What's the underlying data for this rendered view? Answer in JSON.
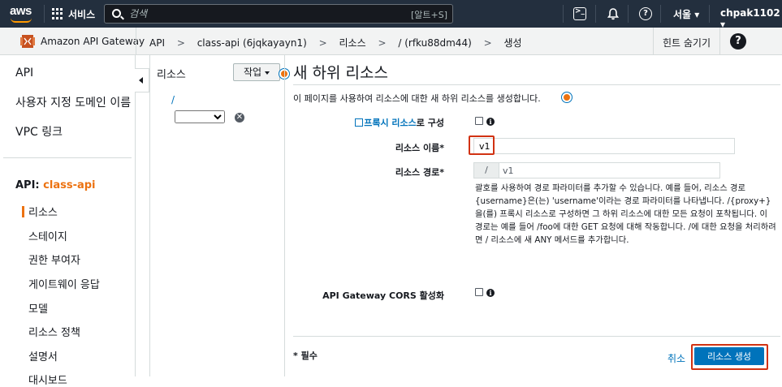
{
  "topbar": {
    "logo": "aws",
    "services_label": "서비스",
    "search_placeholder": "검색",
    "search_shortcut": "[알트+S]",
    "region": "서울 ▾",
    "account": "chpak1102 ▾"
  },
  "breadcrumb_bar": {
    "service_name": "Amazon API Gateway",
    "crumbs": [
      "API",
      "class-api (6jqkayayn1)",
      "리소스",
      "/ (rfku88dm44)",
      "생성"
    ],
    "separator": ">",
    "hint_toggle": "힌트 숨기기",
    "help_icon": "?"
  },
  "left_nav": {
    "items": [
      "API",
      "사용자 지정 도메인 이름",
      "VPC 링크"
    ],
    "api_prefix": "API: ",
    "api_name": "class-api",
    "sub_items": [
      "리소스",
      "스테이지",
      "권한 부여자",
      "게이트웨이 응답",
      "모델",
      "리소스 정책",
      "설명서",
      "대시보드"
    ]
  },
  "resource_panel": {
    "title": "리소스",
    "action_button": "작업",
    "root_path": "/",
    "close_icon": "✕"
  },
  "main": {
    "title": "새 하위 리소스",
    "description": "이 페이지를 사용하여 리소스에 대한 새 하위 리소스를 생성합니다.",
    "proxy_label_link": "프록시 리소스",
    "proxy_label_suffix": "로 구성",
    "resource_name_label": "리소스 이름*",
    "resource_name_value": "v1",
    "resource_path_label": "리소스 경로*",
    "resource_path_prefix": "/",
    "resource_path_value": "v1",
    "path_help": "괄호를 사용하여 경로 파라미터를 추가할 수 있습니다. 예를 들어, 리소스 경로 {username}은(는) 'username'이라는 경로 파라미터를 나타냅니다. /{proxy+}을(를) 프록시 리소스로 구성하면 그 하위 리소스에 대한 모든 요청이 포착됩니다. 이 경로는 예를 들어 /foo에 대한 GET 요청에 대해 작동합니다. /에 대한 요청을 처리하려면 / 리소스에 새 ANY 메서드를 추가합니다.",
    "cors_label": "API Gateway CORS 활성화",
    "info_icon": "i",
    "required_note": "* 필수",
    "cancel_label": "취소",
    "create_button": "리소스 생성"
  },
  "colors": {
    "topbar_bg": "#232f3e",
    "accent_orange": "#ec7211",
    "link_blue": "#0073bb",
    "highlight_red": "#d13212"
  }
}
